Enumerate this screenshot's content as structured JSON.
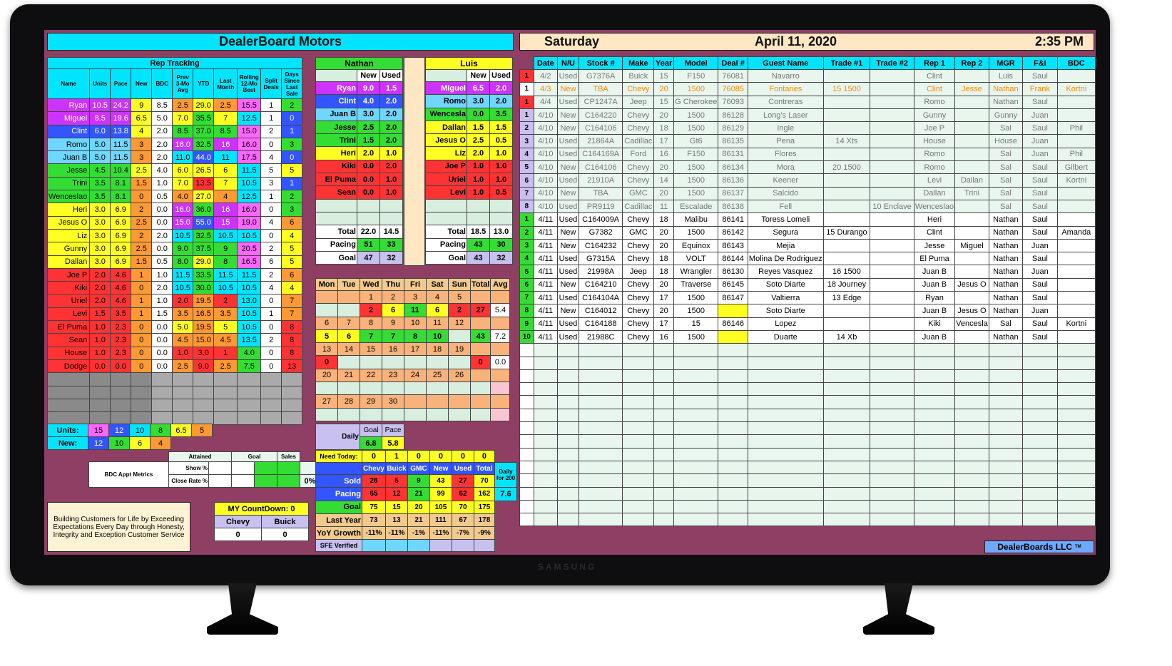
{
  "title": "DealerBoard Motors",
  "day": "Saturday",
  "date": "April 11, 2020",
  "time": "2:35 PM",
  "footer_brand": "DealerBoards LLC",
  "tm": "TM",
  "monitor_brand": "SAMSUNG",
  "rep_tracking": {
    "title": "Rep Tracking",
    "headers": [
      "Name",
      "Units",
      "Pace",
      "New",
      "BDC",
      "Prev 3-Mo Avg",
      "YTD",
      "Last Month",
      "Rolling 12-Mo Best",
      "Split Deals",
      "Days Since Last Sale"
    ],
    "rows": [
      [
        "Ryan",
        "10.5",
        "24.2",
        "9",
        "8.5",
        "2.5",
        "29.0",
        "2.5",
        "15.5",
        "1",
        "2"
      ],
      [
        "Miguel",
        "8.5",
        "19.6",
        "6.5",
        "5.0",
        "7.0",
        "35.5",
        "7",
        "12.5",
        "1",
        "0"
      ],
      [
        "Clint",
        "6.0",
        "13.8",
        "4",
        "2.0",
        "8.5",
        "37.0",
        "8.5",
        "15.0",
        "2",
        "1"
      ],
      [
        "Romo",
        "5.0",
        "11.5",
        "3",
        "2.0",
        "16.0",
        "32.5",
        "16",
        "16.0",
        "0",
        "3"
      ],
      [
        "Juan B",
        "5.0",
        "11.5",
        "3",
        "2.0",
        "11.0",
        "44.0",
        "11",
        "17.5",
        "4",
        "0"
      ],
      [
        "Jesse",
        "4.5",
        "10.4",
        "2.5",
        "4.0",
        "6.0",
        "26.5",
        "6",
        "11.5",
        "5",
        "5"
      ],
      [
        "Trini",
        "3.5",
        "8.1",
        "1.5",
        "1.0",
        "7.0",
        "13.5",
        "7",
        "10.5",
        "3",
        "1"
      ],
      [
        "Wenceslao",
        "3.5",
        "8.1",
        "0",
        "0.5",
        "4.0",
        "27.0",
        "4",
        "12.5",
        "1",
        "2"
      ],
      [
        "Heri",
        "3.0",
        "6.9",
        "2",
        "0.0",
        "16.0",
        "36.0",
        "16",
        "16.0",
        "0",
        "3"
      ],
      [
        "Jesus O",
        "3.0",
        "6.9",
        "2.5",
        "0.0",
        "15.0",
        "55.0",
        "15",
        "19.0",
        "4",
        "6"
      ],
      [
        "Liz",
        "3.0",
        "6.9",
        "2",
        "2.0",
        "10.5",
        "32.5",
        "10.5",
        "10.5",
        "0",
        "4"
      ],
      [
        "Gunny",
        "3.0",
        "6.9",
        "2.5",
        "0.0",
        "9.0",
        "37.5",
        "9",
        "20.5",
        "2",
        "5"
      ],
      [
        "Dallan",
        "3.0",
        "6.9",
        "1.5",
        "0.5",
        "8.0",
        "29.0",
        "8",
        "16.5",
        "6",
        "5"
      ],
      [
        "Joe P",
        "2.0",
        "4.6",
        "1",
        "1.0",
        "11.5",
        "33.5",
        "11.5",
        "11.5",
        "2",
        "6"
      ],
      [
        "Kiki",
        "2.0",
        "4.6",
        "0",
        "2.0",
        "10.5",
        "30.0",
        "10.5",
        "10.5",
        "4",
        "4"
      ],
      [
        "Uriel",
        "2.0",
        "4.6",
        "1",
        "1.0",
        "2.0",
        "19.5",
        "2",
        "13.0",
        "0",
        "7"
      ],
      [
        "Levi",
        "1.5",
        "3.5",
        "1",
        "1.5",
        "3.5",
        "16.5",
        "3.5",
        "10.5",
        "1",
        "7"
      ],
      [
        "El Puma",
        "1.0",
        "2.3",
        "0",
        "0.0",
        "5.0",
        "19.5",
        "5",
        "10.5",
        "0",
        "8"
      ],
      [
        "Sean",
        "1.0",
        "2.3",
        "0",
        "0.0",
        "4.5",
        "15.0",
        "4.5",
        "13.5",
        "2",
        "8"
      ],
      [
        "House",
        "1.0",
        "2.3",
        "0",
        "0.0",
        "1.0",
        "3.0",
        "1",
        "4.0",
        "0",
        "8"
      ],
      [
        "Dodge",
        "0.0",
        "0.0",
        "0",
        "0.0",
        "2.5",
        "9.0",
        "2.5",
        "7.5",
        "0",
        "13"
      ]
    ],
    "units_label": "Units:",
    "units": [
      "15",
      "12",
      "10",
      "8",
      "6.5",
      "5"
    ],
    "new_label": "New:",
    "new": [
      "12",
      "10",
      "6",
      "4"
    ]
  },
  "bdc": {
    "label": "BDC Appt Metrics",
    "cols": [
      "Attained",
      "Goal",
      "Sales"
    ],
    "show": "Show %",
    "close": "Close Rate %",
    "sales": "0%"
  },
  "motto": "Building Customers for Life by Exceeding Expectations Every Day through Honesty, Integrity and Exception Customer Service",
  "countdown": {
    "label": "MY CountDown:",
    "value": "0",
    "cols": [
      "Chevy",
      "Buick"
    ],
    "vals": [
      "0",
      "0"
    ]
  },
  "team_nathan": {
    "name": "Nathan",
    "cols": [
      "New",
      "Used"
    ],
    "rows": [
      [
        "Ryan",
        "9.0",
        "1.5"
      ],
      [
        "Clint",
        "4.0",
        "2.0"
      ],
      [
        "Juan B",
        "3.0",
        "2.0"
      ],
      [
        "Jesse",
        "2.5",
        "2.0"
      ],
      [
        "Trini",
        "1.5",
        "2.0"
      ],
      [
        "Heri",
        "2.0",
        "1.0"
      ],
      [
        "Kiki",
        "0.0",
        "2.0"
      ],
      [
        "El Puma",
        "0.0",
        "1.0"
      ],
      [
        "Sean",
        "0.0",
        "1.0"
      ]
    ],
    "total": [
      "22.0",
      "14.5"
    ],
    "pacing": [
      "51",
      "33"
    ],
    "goal": [
      "47",
      "32"
    ]
  },
  "team_luis": {
    "name": "Luis",
    "cols": [
      "New",
      "Used"
    ],
    "rows": [
      [
        "Miguel",
        "6.5",
        "2.0"
      ],
      [
        "Romo",
        "3.0",
        "2.0"
      ],
      [
        "Wencesla",
        "0.0",
        "3.5"
      ],
      [
        "Dallan",
        "1.5",
        "1.5"
      ],
      [
        "Jesus O",
        "2.5",
        "0.5"
      ],
      [
        "Liz",
        "2.0",
        "1.0"
      ],
      [
        "Joe P",
        "1.0",
        "1.0"
      ],
      [
        "Uriel",
        "1.0",
        "1.0"
      ],
      [
        "Levi",
        "1.0",
        "0.5"
      ]
    ],
    "total": [
      "18.5",
      "13.0"
    ],
    "pacing": [
      "43",
      "30"
    ],
    "goal": [
      "43",
      "32"
    ]
  },
  "team_labels": {
    "total": "Total",
    "pacing": "Pacing",
    "goal": "Goal"
  },
  "calendar": {
    "headers": [
      "Mon",
      "Tue",
      "Wed",
      "Thu",
      "Fri",
      "Sat",
      "Sun",
      "Total",
      "Avg"
    ],
    "weeks": [
      {
        "dates": [
          "",
          "",
          "1",
          "2",
          "3",
          "4",
          "5"
        ],
        "vals": [
          "",
          "",
          "2",
          "6",
          "11",
          "6",
          "2"
        ],
        "total": "27",
        "avg": "5.4"
      },
      {
        "dates": [
          "6",
          "7",
          "8",
          "9",
          "10",
          "11",
          "12"
        ],
        "vals": [
          "5",
          "6",
          "7",
          "7",
          "8",
          "10",
          ""
        ],
        "total": "43",
        "avg": "7.2"
      },
      {
        "dates": [
          "13",
          "14",
          "15",
          "16",
          "17",
          "18",
          "19"
        ],
        "vals": [
          "0",
          "",
          "",
          "",
          "",
          "",
          ""
        ],
        "total": "0",
        "avg": "0.0"
      },
      {
        "dates": [
          "20",
          "21",
          "22",
          "23",
          "24",
          "25",
          "26"
        ],
        "vals": [
          "",
          "",
          "",
          "",
          "",
          "",
          ""
        ],
        "total": "",
        "avg": ""
      },
      {
        "dates": [
          "27",
          "28",
          "29",
          "30",
          "",
          "",
          ""
        ],
        "vals": [
          "",
          "",
          "",
          "",
          "",
          "",
          ""
        ],
        "total": "",
        "avg": ""
      }
    ]
  },
  "daily": {
    "label": "Daily",
    "goal": "Goal",
    "pace": "Pace",
    "goal_val": "6.8",
    "pace_val": "5.8"
  },
  "need_today": {
    "label": "Need Today:",
    "vals": [
      "0",
      "1",
      "0",
      "0",
      "0",
      "0"
    ]
  },
  "brand_stats": {
    "cols": [
      "Chevy",
      "Buick",
      "GMC",
      "New",
      "Used",
      "Total"
    ],
    "extra_label": "Daily for 200",
    "extra_val": "7.6",
    "rows": [
      {
        "label": "Sold",
        "vals": [
          "28",
          "5",
          "9",
          "43",
          "27",
          "70"
        ]
      },
      {
        "label": "Pacing",
        "vals": [
          "65",
          "12",
          "21",
          "99",
          "62",
          "162"
        ]
      },
      {
        "label": "Goal",
        "vals": [
          "75",
          "15",
          "20",
          "105",
          "70",
          "175"
        ]
      },
      {
        "label": "Last Year",
        "vals": [
          "73",
          "13",
          "21",
          "111",
          "67",
          "178"
        ]
      },
      {
        "label": "YoY Growth",
        "vals": [
          "-11%",
          "-11%",
          "-1%",
          "-11%",
          "-7%",
          "-9%"
        ]
      }
    ],
    "sfe": "SFE Verified"
  },
  "deals": {
    "headers": [
      "Date",
      "N/U",
      "Stock #",
      "Make",
      "Year",
      "Model",
      "Deal #",
      "Guest Name",
      "Trade #1",
      "Trade #2",
      "Rep 1",
      "Rep 2",
      "MGR",
      "F&I",
      "BDC"
    ],
    "rows": [
      {
        "n": "1",
        "nc": "rd",
        "d": [
          "4/2",
          "Used",
          "G7376A",
          "Buick",
          "15",
          "F150",
          "76081",
          "Navarro",
          "",
          "",
          "Clint",
          "",
          "Luis",
          "Saul",
          ""
        ]
      },
      {
        "n": "1",
        "nc": "wh",
        "orange": true,
        "d": [
          "4/3",
          "New",
          "TBA",
          "Chevy",
          "20",
          "1500",
          "76085",
          "Fontanes",
          "15 1500",
          "",
          "Clint",
          "Jesse",
          "Nathan",
          "Frank",
          "Kortni"
        ]
      },
      {
        "n": "1",
        "nc": "rd",
        "d": [
          "4/4",
          "Used",
          "CP1247A",
          "Jeep",
          "15",
          "G Cherokee",
          "76093",
          "Contreras",
          "",
          "",
          "Romo",
          "",
          "Nathan",
          "Saul",
          ""
        ]
      },
      {
        "n": "1",
        "nc": "lav",
        "d": [
          "4/10",
          "New",
          "C164220",
          "Chevy",
          "20",
          "1500",
          "86128",
          "Long's Laser",
          "",
          "",
          "Gunny",
          "",
          "Gunny",
          "Juan",
          ""
        ]
      },
      {
        "n": "2",
        "nc": "lav",
        "d": [
          "4/10",
          "New",
          "C164106",
          "Chevy",
          "18",
          "1500",
          "86129",
          "Ingle",
          "",
          "",
          "Joe P",
          "",
          "Sal",
          "Saul",
          "Phil"
        ]
      },
      {
        "n": "3",
        "nc": "lav",
        "d": [
          "4/10",
          "Used",
          "21864A",
          "Cadillac",
          "17",
          "Gt6",
          "86135",
          "Pena",
          "14 Xts",
          "",
          "House",
          "",
          "House",
          "Juan",
          ""
        ]
      },
      {
        "n": "4",
        "nc": "lav",
        "d": [
          "4/10",
          "Used",
          "C164169A",
          "Ford",
          "16",
          "F150",
          "86131",
          "Flores",
          "",
          "",
          "Romo",
          "",
          "Sal",
          "Juan",
          "Phil"
        ]
      },
      {
        "n": "5",
        "nc": "lav",
        "d": [
          "4/10",
          "New",
          "C164106",
          "Chevy",
          "20",
          "1500",
          "86134",
          "Mora",
          "20 1500",
          "",
          "Romo",
          "",
          "Sal",
          "Saul",
          "Gilbert"
        ]
      },
      {
        "n": "6",
        "nc": "lav",
        "d": [
          "4/10",
          "Used",
          "21910A",
          "Chevy",
          "14",
          "1500",
          "86136",
          "Keener",
          "",
          "",
          "Levi",
          "Dallan",
          "Sal",
          "Saul",
          "Kortni"
        ]
      },
      {
        "n": "7",
        "nc": "lav",
        "d": [
          "4/10",
          "New",
          "TBA",
          "GMC",
          "20",
          "1500",
          "86137",
          "Salcido",
          "",
          "",
          "Dallan",
          "Trini",
          "Sal",
          "Saul",
          ""
        ]
      },
      {
        "n": "8",
        "nc": "lav",
        "d": [
          "4/10",
          "Used",
          "PR9119",
          "Cadillac",
          "11",
          "Escalade",
          "86138",
          "Fell",
          "",
          "10 Enclave",
          "Wenceslao",
          "",
          "Sal",
          "Saul",
          ""
        ]
      },
      {
        "n": "1",
        "nc": "gr",
        "d": [
          "4/11",
          "Used",
          "C164009A",
          "Chevy",
          "18",
          "Malibu",
          "86141",
          "Toress Lomeli",
          "",
          "",
          "Heri",
          "",
          "Nathan",
          "Saul",
          ""
        ]
      },
      {
        "n": "2",
        "nc": "gr",
        "d": [
          "4/11",
          "New",
          "G7382",
          "GMC",
          "20",
          "1500",
          "86142",
          "Segura",
          "15 Durango",
          "",
          "Clint",
          "",
          "Nathan",
          "Saul",
          "Amanda"
        ]
      },
      {
        "n": "3",
        "nc": "gr",
        "d": [
          "4/11",
          "New",
          "C164232",
          "Chevy",
          "20",
          "Equinox",
          "86143",
          "Mejia",
          "",
          "",
          "Jesse",
          "Miguel",
          "Nathan",
          "Juan",
          ""
        ]
      },
      {
        "n": "4",
        "nc": "gr",
        "d": [
          "4/11",
          "Used",
          "G7315A",
          "Chevy",
          "18",
          "VOLT",
          "86144",
          "Molina De Rodriguez",
          "",
          "",
          "El Puma",
          "",
          "Nathan",
          "Saul",
          ""
        ]
      },
      {
        "n": "5",
        "nc": "gr",
        "d": [
          "4/11",
          "Used",
          "21998A",
          "Jeep",
          "18",
          "Wrangler",
          "86130",
          "Reyes Vasquez",
          "16 1500",
          "",
          "Juan B",
          "",
          "Nathan",
          "Juan",
          ""
        ]
      },
      {
        "n": "6",
        "nc": "gr",
        "d": [
          "4/11",
          "New",
          "C164210",
          "Chevy",
          "20",
          "Traverse",
          "86145",
          "Soto Diarte",
          "18 Journey",
          "",
          "Juan B",
          "Jesus O",
          "Nathan",
          "Saul",
          ""
        ]
      },
      {
        "n": "7",
        "nc": "gr",
        "d": [
          "4/11",
          "Used",
          "C164104A",
          "Chevy",
          "17",
          "1500",
          "86147",
          "Valtierra",
          "13 Edge",
          "",
          "Ryan",
          "",
          "Nathan",
          "Saul",
          ""
        ]
      },
      {
        "n": "8",
        "nc": "gr",
        "yellow": true,
        "d": [
          "4/11",
          "New",
          "C164012",
          "Chevy",
          "20",
          "1500",
          "",
          "Soto Diarte",
          "",
          "",
          "Juan B",
          "Jesus O",
          "Nathan",
          "Juan",
          ""
        ]
      },
      {
        "n": "9",
        "nc": "gr",
        "d": [
          "4/11",
          "Used",
          "C164188",
          "Chevy",
          "17",
          "15",
          "86146",
          "Lopez",
          "",
          "",
          "Kiki",
          "Vencesla",
          "Sal",
          "Saul",
          "Kortni"
        ]
      },
      {
        "n": "10",
        "nc": "gr",
        "yellow": true,
        "d": [
          "4/11",
          "Used",
          "21988C",
          "Chevy",
          "16",
          "1500",
          "",
          "Duarte",
          "14 Xb",
          "",
          "Juan B",
          "",
          "Nathan",
          "Saul",
          ""
        ]
      }
    ]
  }
}
